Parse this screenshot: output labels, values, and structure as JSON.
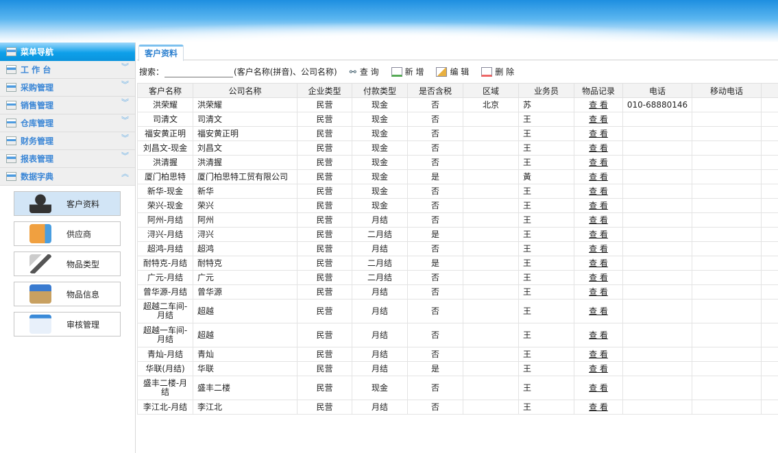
{
  "sidebar": {
    "title": "菜单导航",
    "menus": [
      {
        "label": "工 作 台",
        "expanded": false
      },
      {
        "label": "采购管理",
        "expanded": false
      },
      {
        "label": "销售管理",
        "expanded": false
      },
      {
        "label": "仓库管理",
        "expanded": false
      },
      {
        "label": "财务管理",
        "expanded": false
      },
      {
        "label": "报表管理",
        "expanded": false
      },
      {
        "label": "数据字典",
        "expanded": true
      }
    ],
    "subitems": [
      {
        "label": "客户资料",
        "icon": "user-icon",
        "active": true
      },
      {
        "label": "供应商",
        "icon": "truck-icon"
      },
      {
        "label": "物品类型",
        "icon": "hammer-icon"
      },
      {
        "label": "物品信息",
        "icon": "box-icon"
      },
      {
        "label": "审核管理",
        "icon": "key-icon"
      }
    ]
  },
  "tab": "客户资料",
  "toolbar": {
    "search_label": "搜索：",
    "search_value": "",
    "hint": "(客户名称(拼音)、公司名称)",
    "query": "查 询",
    "add": "新 增",
    "edit": "编 辑",
    "delete": "删 除"
  },
  "table": {
    "columns": [
      "客户名称",
      "公司名称",
      "企业类型",
      "付款类型",
      "是否含税",
      "区域",
      "业务员",
      "物品记录",
      "电话",
      "移动电话"
    ],
    "link_label": "查 看",
    "rows": [
      [
        "洪荣耀",
        "洪荣耀",
        "民营",
        "现金",
        "否",
        "北京",
        "苏",
        "查 看",
        "010-68880146",
        ""
      ],
      [
        "司清文",
        "司清文",
        "民营",
        "现金",
        "否",
        "",
        "王",
        "查 看",
        "",
        ""
      ],
      [
        "福安黄正明",
        "福安黄正明",
        "民营",
        "现金",
        "否",
        "",
        "王",
        "查 看",
        "",
        ""
      ],
      [
        "刘昌文-现金",
        "刘昌文",
        "民营",
        "现金",
        "否",
        "",
        "王",
        "查 看",
        "",
        ""
      ],
      [
        "洪清握",
        "洪清握",
        "民营",
        "现金",
        "否",
        "",
        "王",
        "查 看",
        "",
        ""
      ],
      [
        "厦门柏思特",
        "厦门柏思特工贸有限公司",
        "民营",
        "现金",
        "是",
        "",
        "黃",
        "查 看",
        "",
        ""
      ],
      [
        "新华-现金",
        "新华",
        "民营",
        "现金",
        "否",
        "",
        "王",
        "查 看",
        "",
        ""
      ],
      [
        "荣兴-现金",
        "荣兴",
        "民营",
        "现金",
        "否",
        "",
        "王",
        "查 看",
        "",
        ""
      ],
      [
        "阿州-月结",
        "阿州",
        "民营",
        "月结",
        "否",
        "",
        "王",
        "查 看",
        "",
        ""
      ],
      [
        "浔兴-月结",
        "浔兴",
        "民营",
        "二月结",
        "是",
        "",
        "王",
        "查 看",
        "",
        ""
      ],
      [
        "超鸿-月结",
        "超鸿",
        "民营",
        "月结",
        "否",
        "",
        "王",
        "查 看",
        "",
        ""
      ],
      [
        "耐特克-月结",
        "耐特克",
        "民营",
        "二月结",
        "是",
        "",
        "王",
        "查 看",
        "",
        ""
      ],
      [
        "广元-月结",
        "广元",
        "民营",
        "二月结",
        "否",
        "",
        "王",
        "查 看",
        "",
        ""
      ],
      [
        "曾华源-月结",
        "曾华源",
        "民营",
        "月结",
        "否",
        "",
        "王",
        "查 看",
        "",
        ""
      ],
      [
        "超越二车间-月结",
        "超越",
        "民营",
        "月结",
        "否",
        "",
        "王",
        "查 看",
        "",
        ""
      ],
      [
        "超越一车间-月结",
        "超越",
        "民营",
        "月结",
        "否",
        "",
        "王",
        "查 看",
        "",
        ""
      ],
      [
        "青灿-月结",
        "青灿",
        "民营",
        "月结",
        "否",
        "",
        "王",
        "查 看",
        "",
        ""
      ],
      [
        "华联(月结)",
        "华联",
        "民营",
        "月结",
        "是",
        "",
        "王",
        "查 看",
        "",
        ""
      ],
      [
        "盛丰二楼-月结",
        "盛丰二楼",
        "民营",
        "现金",
        "否",
        "",
        "王",
        "查 看",
        "",
        ""
      ],
      [
        "李江北-月结",
        "李江北",
        "民营",
        "月结",
        "否",
        "",
        "王",
        "查 看",
        "",
        ""
      ]
    ]
  }
}
